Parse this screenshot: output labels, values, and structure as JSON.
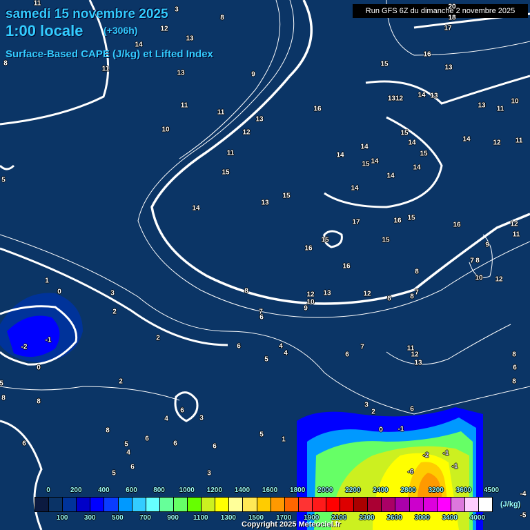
{
  "header": {
    "date": "samedi 15 novembre 2025",
    "time": "1:00 locale",
    "lead": "(+306h)",
    "product": "Surface-Based CAPE (J/kg) et Lifted Index",
    "run": "Run GFS 6Z du dimanche 2 novembre 2025"
  },
  "legend": {
    "unit": "(J/kg)",
    "top_labels": [
      "0",
      "200",
      "400",
      "600",
      "800",
      "1000",
      "1200",
      "1400",
      "1600",
      "1800",
      "2000",
      "2200",
      "2400",
      "2800",
      "3200",
      "3600",
      "4500"
    ],
    "bottom_labels": [
      "100",
      "300",
      "500",
      "700",
      "900",
      "1100",
      "1300",
      "1500",
      "1700",
      "1900",
      "2100",
      "2300",
      "2600",
      "3000",
      "3400",
      "4000"
    ],
    "colors": [
      "#0b1a40",
      "#0a3366",
      "#00339a",
      "#0000c8",
      "#0000ff",
      "#0a3cff",
      "#0099ff",
      "#33ccff",
      "#66ffff",
      "#66ff99",
      "#66ff66",
      "#66ff00",
      "#ccf020",
      "#ffff00",
      "#ffff99",
      "#ffe855",
      "#ffcc00",
      "#ff9900",
      "#ff6600",
      "#ff3333",
      "#ff1a1a",
      "#ff0000",
      "#dd0000",
      "#aa0000",
      "#aa0033",
      "#aa0066",
      "#aa00aa",
      "#cc00cc",
      "#dd00dd",
      "#ff00ff",
      "#dd77dd",
      "#ffccff",
      "#ffffff"
    ]
  },
  "map": {
    "contour_labels": [
      "11",
      "3",
      "8",
      "12",
      "13",
      "14",
      "11",
      "13",
      "8",
      "9",
      "11",
      "11",
      "10",
      "12",
      "13",
      "11",
      "15",
      "14",
      "13",
      "15",
      "16",
      "15",
      "16",
      "13",
      "1312",
      "14",
      "13",
      "13",
      "11",
      "10",
      "15",
      "14",
      "15",
      "14",
      "14",
      "15",
      "14",
      "14",
      "14",
      "14",
      "14",
      "12",
      "11",
      "17",
      "16",
      "15",
      "16",
      "12",
      "11",
      "15",
      "16",
      "15",
      "16",
      "9",
      "7",
      "8",
      "10",
      "12",
      "12",
      "8",
      "8",
      "7",
      "12",
      "13",
      "10",
      "9",
      "8",
      "7",
      "6",
      "8",
      "11",
      "12",
      "13",
      "8",
      "6",
      "8",
      "7",
      "6",
      "4",
      "4",
      "5",
      "6",
      "5",
      "1",
      "0",
      "3",
      "2",
      "2",
      "-2",
      "-1",
      "0",
      "5",
      "2",
      "8",
      "8",
      "4",
      "6",
      "3",
      "8",
      "6",
      "6",
      "5",
      "4",
      "6",
      "6",
      "6",
      "5",
      "3",
      "5",
      "1",
      "3",
      "2",
      "6",
      "0",
      "-1",
      "-2",
      "-1",
      "-6",
      "-1",
      "-4",
      "-5",
      "18",
      "17",
      "20"
    ]
  },
  "copyright": "Copyright 2025 Meteociel.fr"
}
